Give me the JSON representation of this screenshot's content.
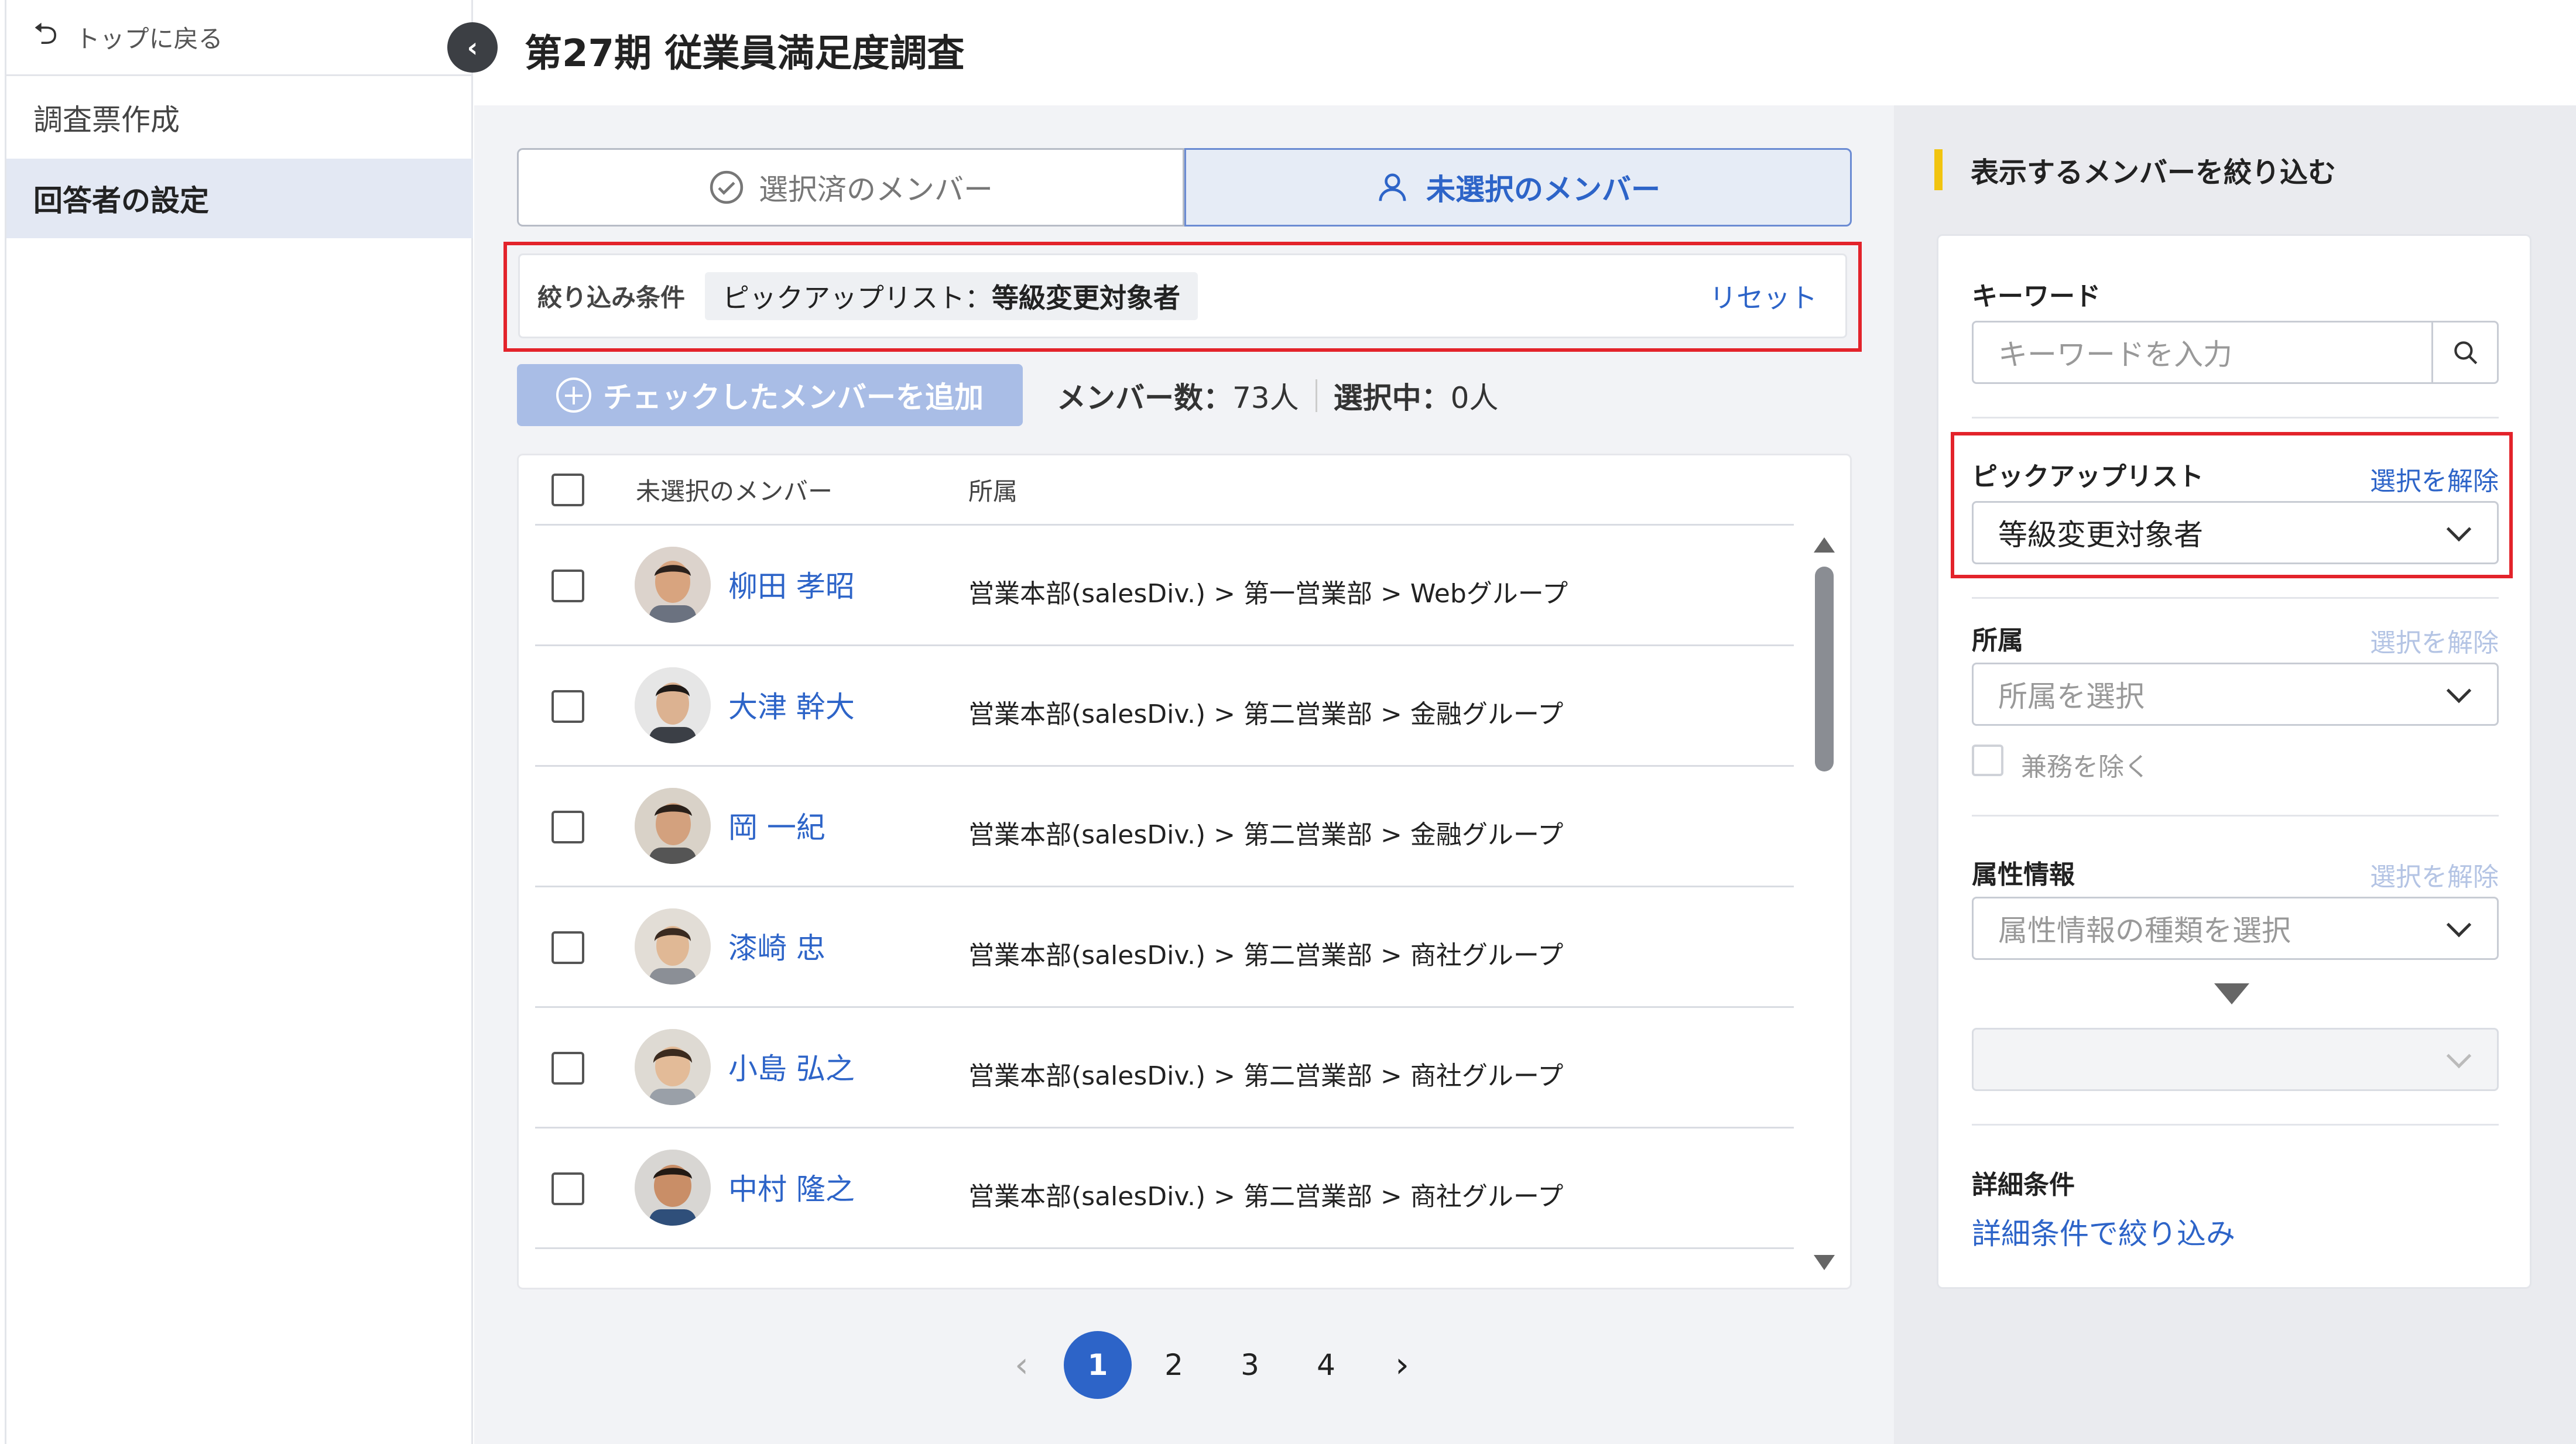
{
  "sidebar": {
    "back_label": "トップに戻る",
    "items": [
      {
        "label": "調査票作成",
        "active": false
      },
      {
        "label": "回答者の設定",
        "active": true
      }
    ]
  },
  "header": {
    "title": "第27期 従業員満足度調査"
  },
  "tabs": [
    {
      "label": "選択済のメンバー",
      "active": false,
      "icon": "check-circle-icon"
    },
    {
      "label": "未選択のメンバー",
      "active": true,
      "icon": "user-icon"
    }
  ],
  "filter": {
    "label": "絞り込み条件",
    "chip_key": "ピックアップリスト：",
    "chip_value": "等級変更対象者",
    "reset": "リセット"
  },
  "actions": {
    "add_button": "チェックしたメンバーを追加",
    "member_count_label": "メンバー数：",
    "member_count_value": "73人",
    "selected_label": "選択中：",
    "selected_value": "0人"
  },
  "table": {
    "col_name": "未選択のメンバー",
    "col_dept": "所属",
    "rows": [
      {
        "name": "柳田 孝昭",
        "dept": "営業本部(salesDiv.) > 第一営業部 > Webグループ"
      },
      {
        "name": "大津 幹大",
        "dept": "営業本部(salesDiv.) > 第二営業部 > 金融グループ"
      },
      {
        "name": "岡 一紀",
        "dept": "営業本部(salesDiv.) > 第二営業部 > 金融グループ"
      },
      {
        "name": "漆崎 忠",
        "dept": "営業本部(salesDiv.) > 第二営業部 > 商社グループ"
      },
      {
        "name": "小島 弘之",
        "dept": "営業本部(salesDiv.) > 第二営業部 > 商社グループ"
      },
      {
        "name": "中村 隆之",
        "dept": "営業本部(salesDiv.) > 第二営業部 > 商社グループ"
      }
    ]
  },
  "pagination": {
    "pages": [
      "1",
      "2",
      "3",
      "4"
    ],
    "current": "1",
    "prev": "‹",
    "next": "›"
  },
  "panel": {
    "title": "表示するメンバーを絞り込む",
    "keyword": {
      "label": "キーワード",
      "placeholder": "キーワードを入力"
    },
    "pickup": {
      "label": "ピックアップリスト",
      "clear": "選択を解除",
      "value": "等級変更対象者"
    },
    "dept": {
      "label": "所属",
      "clear": "選択を解除",
      "placeholder": "所属を選択",
      "exclude": "兼務を除く"
    },
    "attr": {
      "label": "属性情報",
      "clear": "選択を解除",
      "placeholder": "属性情報の種類を選択"
    },
    "detail": {
      "label": "詳細条件",
      "link": "詳細条件で絞り込み"
    }
  },
  "colors": {
    "accent": "#2d64c8",
    "highlight": "#e3232b",
    "marker": "#f1c40f"
  }
}
